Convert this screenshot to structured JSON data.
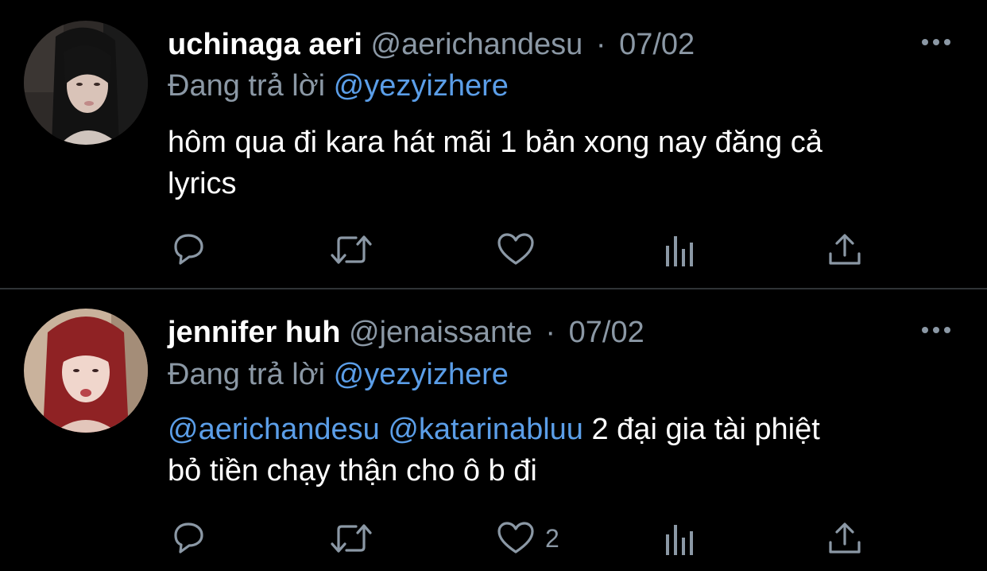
{
  "tweets": [
    {
      "display_name": "uchinaga aeri",
      "handle": "@aerichandesu",
      "separator": "·",
      "date": "07/02",
      "reply_prefix": "Đang trả lời",
      "reply_to": "@yezyizhere",
      "body_line_1": "hôm qua đi kara hát mãi 1 bản xong nay đăng cả",
      "body_line_2": "lyrics",
      "like_count": ""
    },
    {
      "display_name": "jennifer huh",
      "handle": "@jenaissante",
      "separator": "·",
      "date": "07/02",
      "reply_prefix": "Đang trả lời",
      "reply_to": "@yezyizhere",
      "body_mention_1": "@aerichandesu",
      "body_mention_2": "@katarinabluu",
      "body_line_1_rest": "2 đại gia tài phiệt",
      "body_line_2": "bỏ tiền chạy thận cho ô b đi",
      "like_count": "2"
    }
  ],
  "icons": {
    "more": "more-horizontal-icon",
    "reply": "reply-bubble-icon",
    "retweet": "retweet-icon",
    "like": "heart-icon",
    "views": "bar-chart-icon",
    "share": "share-upload-icon"
  },
  "colors": {
    "background": "#000000",
    "name": "#ffffff",
    "muted": "#8b98a5",
    "mention": "#5b9ee8",
    "divider": "#2f3336"
  }
}
